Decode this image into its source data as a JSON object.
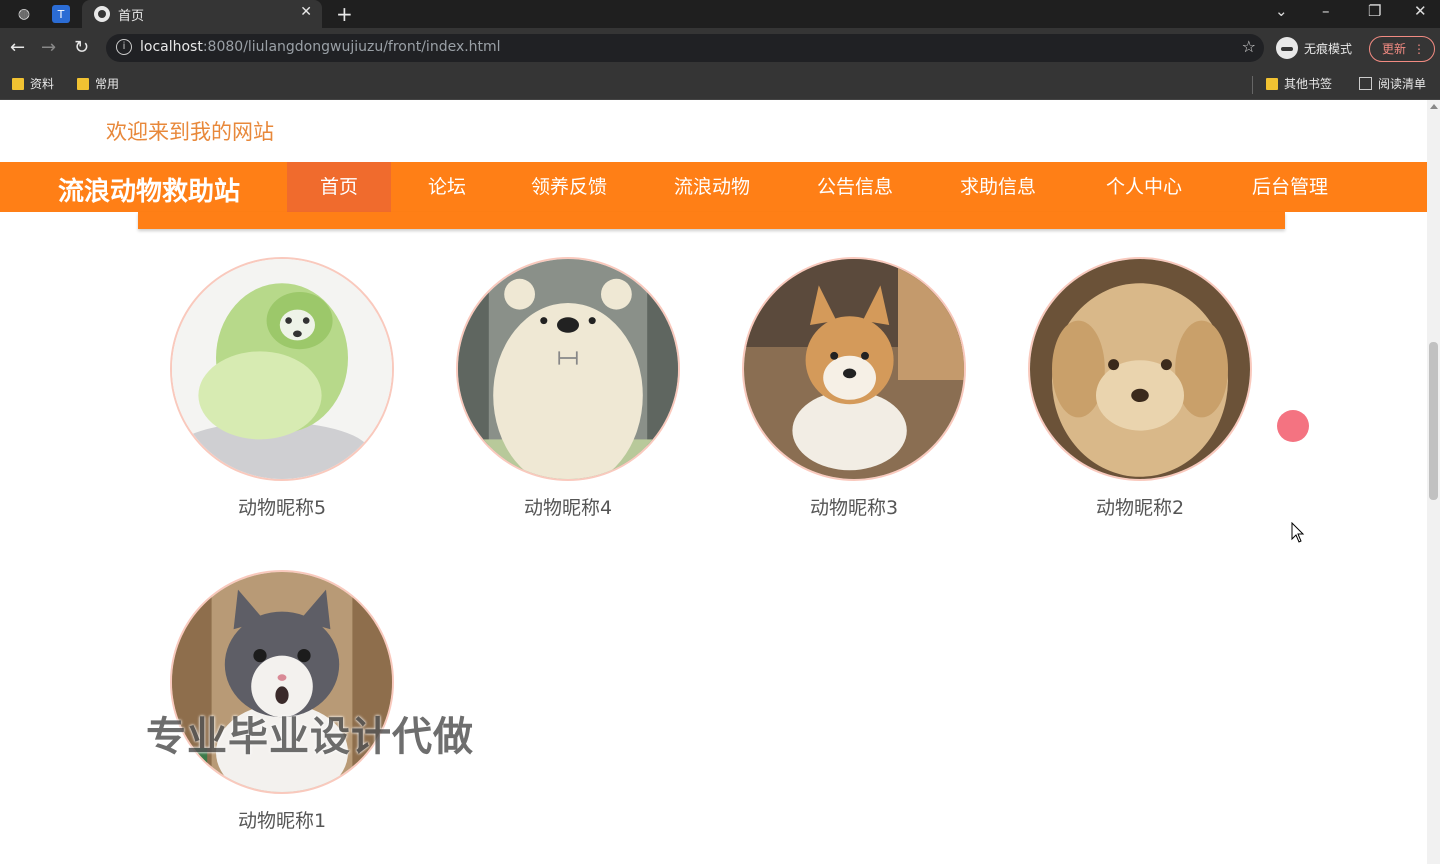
{
  "browser": {
    "tab_title": "首页",
    "url_host": "localhost",
    "url_rest": ":8080/liulangdongwujiuzu/front/index.html",
    "incognito_label": "无痕模式",
    "update_label": "更新",
    "bookmarks": [
      "资料",
      "常用"
    ],
    "other_bookmarks": "其他书签",
    "reading_list": "阅读清单"
  },
  "header": {
    "welcome": "欢迎来到我的网站",
    "site_title": "流浪动物救助站"
  },
  "nav": {
    "items": [
      {
        "label": "首页",
        "active": true
      },
      {
        "label": "论坛"
      },
      {
        "label": "领养反馈"
      },
      {
        "label": "流浪动物"
      },
      {
        "label": "公告信息"
      },
      {
        "label": "求助信息"
      },
      {
        "label": "个人中心"
      },
      {
        "label": "后台管理"
      }
    ]
  },
  "animals": [
    {
      "name": "动物昵称5",
      "image": "cabbage-dog-photo"
    },
    {
      "name": "动物昵称4",
      "image": "white-bear-cartoon"
    },
    {
      "name": "动物昵称3",
      "image": "shiba-dog-photo"
    },
    {
      "name": "动物昵称2",
      "image": "puppy-photo"
    },
    {
      "name": "动物昵称1",
      "image": "cat-photo"
    }
  ],
  "watermark": "专业毕业设计代做",
  "colors": {
    "accent": "#ff7f16",
    "active_nav": "#f06b2d",
    "welcome_text": "#e8883a"
  }
}
